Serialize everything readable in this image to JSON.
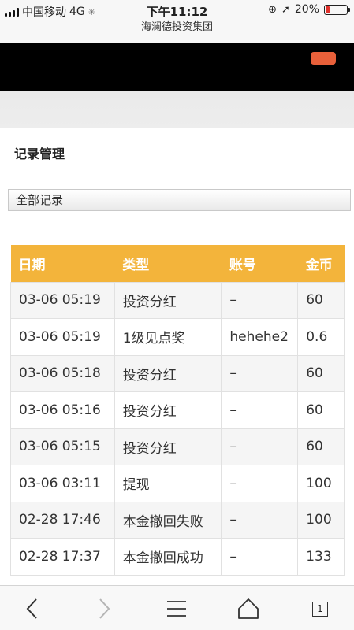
{
  "statusbar": {
    "carrier": "中国移动",
    "network": "4G",
    "time": "下午11:12",
    "battery_percent": "20%",
    "battery_level": 0.2,
    "battery_color": "#e0312b"
  },
  "addressbar": {
    "site_title": "海澜德投资集团"
  },
  "header": {
    "button_color": "#e8603a"
  },
  "page": {
    "title": "记录管理"
  },
  "filter": {
    "selected": "全部记录"
  },
  "table": {
    "header_color": "#f3b43b",
    "columns": [
      "日期",
      "类型",
      "账号",
      "金币"
    ],
    "rows": [
      [
        "03-06 05:19",
        "投资分红",
        "–",
        "60"
      ],
      [
        "03-06 05:19",
        "1级见点奖",
        "hehehe2",
        "0.6"
      ],
      [
        "03-06 05:18",
        "投资分红",
        "–",
        "60"
      ],
      [
        "03-06 05:16",
        "投资分红",
        "–",
        "60"
      ],
      [
        "03-06 05:15",
        "投资分红",
        "–",
        "60"
      ],
      [
        "03-06 03:11",
        "提现",
        "–",
        "100"
      ],
      [
        "02-28 17:46",
        "本金撤回失败",
        "–",
        "100"
      ],
      [
        "02-28 17:37",
        "本金撤回成功",
        "–",
        "133"
      ]
    ]
  },
  "toolbar": {
    "icons": [
      "back-icon",
      "forward-icon",
      "menu-icon",
      "home-icon",
      "tabs-icon"
    ],
    "tab_count": "1"
  }
}
